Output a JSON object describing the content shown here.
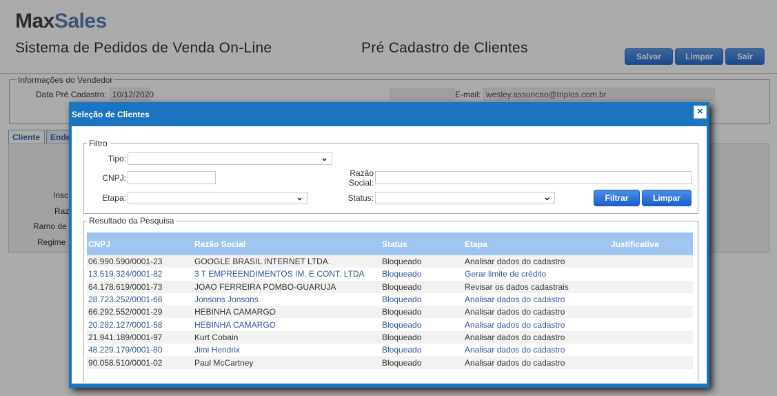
{
  "header": {
    "logo_max": "Max",
    "logo_sales": "Sales",
    "app_title": "Sistema de Pedidos de Venda On-Line",
    "page_title": "Pré Cadastro de Clientes",
    "buttons": {
      "salvar": "Salvar",
      "limpar": "Limpar",
      "sair": "Sair"
    }
  },
  "vendor": {
    "legend": "Informações do Vendedor",
    "data_label": "Data Pré Cadastro:",
    "data_value": "10/12/2020",
    "email_label": "E-mail:",
    "email_value": "wesley.assuncao@triplos.com.br"
  },
  "tabs": {
    "cliente": "Cliente",
    "endereco": "Endereço"
  },
  "side_labels": {
    "insc": "Insc",
    "raz": "Raz",
    "ramo": "Ramo de",
    "regime": "Regime"
  },
  "modal": {
    "title": "Seleção de Clientes",
    "close": "×",
    "filtro": {
      "legend": "Filtro",
      "tipo_label": "Tipo:",
      "cnpj_label": "CNPJ:",
      "etapa_label": "Etapa:",
      "razao_label_1": "Razão",
      "razao_label_2": "Social:",
      "status_label": "Status:",
      "filtrar_button": "Filtrar",
      "limpar_button": "Limpar"
    },
    "resultado": {
      "legend": "Resultado da Pesquisa",
      "columns": {
        "cnpj": "CNPJ",
        "razao": "Razão Social",
        "status": "Status",
        "etapa": "Etapa",
        "justificativa": "Justificativa"
      },
      "rows": [
        {
          "cnpj": "06.990.590/0001-23",
          "razao": "GOOGLE BRASIL INTERNET LTDA.",
          "status": "Bloqueado",
          "etapa": "Analisar dados do cadastro",
          "justificativa": ""
        },
        {
          "cnpj": "13.519.324/0001-82",
          "razao": "3 T EMPREENDIMENTOS IM. E CONT. LTDA",
          "status": "Bloqueado",
          "etapa": "Gerar limite de crédito",
          "justificativa": ""
        },
        {
          "cnpj": "64.178.619/0001-73",
          "razao": "JOAO FERREIRA POMBO-GUARUJA",
          "status": "Bloqueado",
          "etapa": "Revisar os dados cadastrais",
          "justificativa": ""
        },
        {
          "cnpj": "28.723.252/0001-68",
          "razao": "Jonsons Jonsons",
          "status": "Bloqueado",
          "etapa": "Analisar dados do cadastro",
          "justificativa": ""
        },
        {
          "cnpj": "66.292.552/0001-29",
          "razao": "HEBINHA CAMARGO",
          "status": "Bloqueado",
          "etapa": "Analisar dados do cadastro",
          "justificativa": ""
        },
        {
          "cnpj": "20.282.127/0001-58",
          "razao": "HEBINHA CAMARGO",
          "status": "Bloqueado",
          "etapa": "Analisar dados do cadastro",
          "justificativa": ""
        },
        {
          "cnpj": "21.941.189/0001-97",
          "razao": "Kurt Cobain",
          "status": "Bloqueado",
          "etapa": "Analisar dados do cadastro",
          "justificativa": ""
        },
        {
          "cnpj": "48.229.179/0001-80",
          "razao": "Jimi Hendrix",
          "status": "Bloqueado",
          "etapa": "Analisar dados do cadastro",
          "justificativa": ""
        },
        {
          "cnpj": "90.058.510/0001-02",
          "razao": "Paul McCartney",
          "status": "Bloqueado",
          "etapa": "Analisar dados do cadastro",
          "justificativa": ""
        }
      ]
    }
  },
  "colors": {
    "modal_frame": "#1a74c0",
    "table_header": "#9fc6f0",
    "link_text": "#2b5a9a",
    "button": "#1a5fcf"
  }
}
